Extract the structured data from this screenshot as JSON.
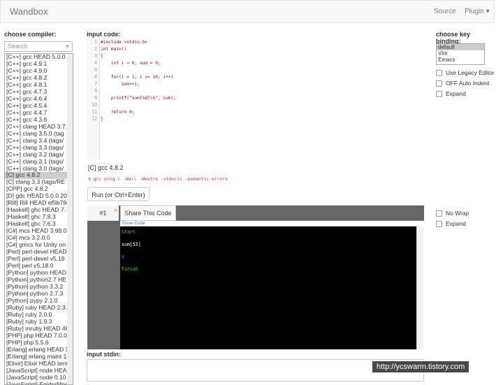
{
  "navbar": {
    "brand": "Wandbox",
    "source": "Source",
    "plugin": "Plugin ▾"
  },
  "compilers": {
    "label": "choose compiler:",
    "search_placeholder": "Search",
    "clear_symbol": "×",
    "items": [
      "[C++] gcc HEAD 5.0.0",
      "[C++] gcc 4.9.1",
      "[C++] gcc 4.9.0",
      "[C++] gcc 4.8.2",
      "[C++] gcc 4.8.1",
      "[C++] gcc 4.7.3",
      "[C++] gcc 4.6.4",
      "[C++] gcc 4.5.4",
      "[C++] gcc 4.4.7",
      "[C++] gcc 4.3.6",
      "[C++] clang HEAD 3.7.",
      "[C++] clang 3.5.0 (tag",
      "[C++] clang 3.4 (tags/",
      "[C++] clang 3.3 (tags/",
      "[C++] clang 3.2 (tags/",
      "[C++] clang 3.1 (tags/",
      "[C++] clang 3.0 (tags/",
      "[C] gcc 4.8.2",
      "[C] clang 3.3 (tags/RE",
      "[CPP] gcc 4.8.2",
      "[D] gdc HEAD 5.0.0 20",
      "[Rill] Rill HEAD ef5b79c",
      "[Haskell] ghc HEAD 7.",
      "[Haskell] ghc 7.8.3",
      "[Haskell] ghc 7.6.3",
      "[C#] mcs HEAD 3.99.0",
      "[C#] mcs 3.2.0.0",
      "[C#] gmcs for Unity on",
      "[Perl] perl-devel HEAD",
      "[Perl] perl-devel v5.19",
      "[Perl] perl v5.18.0",
      "[Python] python HEAD",
      "[Python] python2.7 HE",
      "[Python] python 3.3.2",
      "[Python] python 2.7.3",
      "[Python] pypy 2.1.0",
      "[Ruby] ruby HEAD 2.3.",
      "[Ruby] ruby 2.0.0",
      "[Ruby] ruby 1.9.3",
      "[Ruby] mruby HEAD 46",
      "[PHP] php HEAD 7.0.0",
      "[PHP] php 5.5.6",
      "[Erlang] erlang HEAD 1",
      "[Erlang] erlang maint 1",
      "[Elixir] Elixir HEAD term",
      "[JavaScript] node HEA",
      "[JavaScript] node 0.10",
      "[JavaScript] SpiderMon"
    ]
  },
  "editor": {
    "label": "input code:",
    "lines": [
      "#include <stdio.h>",
      "int main()",
      "{",
      "    int i = 0, sum = 0;",
      "",
      "    for(i = 1; i <= 10; i++)",
      "        sum+=i;",
      "",
      "    printf(\"sum[%d]\\n\", sum);",
      "",
      "    return 0;",
      "}"
    ]
  },
  "compile": {
    "compiler_name": "[C] gcc 4.8.2",
    "command": "$ gcc prog.c -Wall -Wextra -std=c11 -pedantic-errors",
    "run_label": "Run (or Ctrl+Enter)"
  },
  "output": {
    "tab_label": "#1",
    "close_symbol": "×",
    "share_label": "Share This Code",
    "show_code": "Show Code",
    "lines": [
      {
        "text": "Start",
        "color": "#33dd33"
      },
      {
        "text": "sum[55]",
        "color": "#ffffff"
      },
      {
        "text": "0",
        "color": "#aa33ff"
      },
      {
        "text": "Finish",
        "color": "#33dd33"
      }
    ]
  },
  "stdin": {
    "label": "input stdin:"
  },
  "keybinding": {
    "label": "choose key binding:",
    "options": [
      "default",
      "Vim",
      "Emacs"
    ],
    "checkboxes": [
      "Use Legacy Editor",
      "OFF Auto Indent",
      "Expand"
    ]
  },
  "output_options": [
    "No Wrap",
    "Expand"
  ],
  "watermark": "http://ycswarm.tistory.com"
}
